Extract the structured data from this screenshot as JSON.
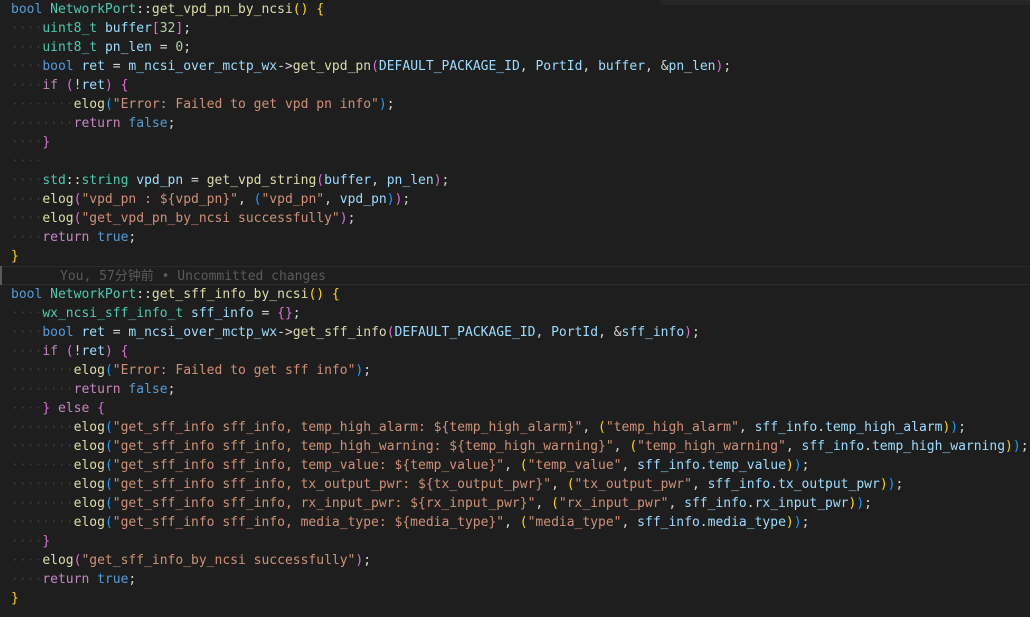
{
  "editor": {
    "blame_text": "You, 57分钟前 • Uncommitted changes",
    "lines": [
      [
        [
          "kw",
          "bool"
        ],
        [
          "op",
          " "
        ],
        [
          "type",
          "NetworkPort"
        ],
        [
          "op",
          "::"
        ],
        [
          "fn",
          "get_vpd_pn_by_ncsi"
        ],
        [
          "b1",
          "()"
        ],
        [
          "op",
          " "
        ],
        [
          "b1",
          "{"
        ]
      ],
      [
        [
          "ws",
          "····"
        ],
        [
          "type",
          "uint8_t"
        ],
        [
          "op",
          " "
        ],
        [
          "var",
          "buffer"
        ],
        [
          "b2",
          "["
        ],
        [
          "num",
          "32"
        ],
        [
          "b2",
          "]"
        ],
        [
          "op",
          ";"
        ]
      ],
      [
        [
          "ws",
          "····"
        ],
        [
          "type",
          "uint8_t"
        ],
        [
          "op",
          " "
        ],
        [
          "var",
          "pn_len"
        ],
        [
          "op",
          " = "
        ],
        [
          "num",
          "0"
        ],
        [
          "op",
          ";"
        ]
      ],
      [
        [
          "ws",
          "····"
        ],
        [
          "kw",
          "bool"
        ],
        [
          "op",
          " "
        ],
        [
          "var",
          "ret"
        ],
        [
          "op",
          " = "
        ],
        [
          "var",
          "m_ncsi_over_mctp_wx"
        ],
        [
          "op",
          "->"
        ],
        [
          "fn",
          "get_vpd_pn"
        ],
        [
          "b2",
          "("
        ],
        [
          "mac",
          "DEFAULT_PACKAGE_ID"
        ],
        [
          "op",
          ", "
        ],
        [
          "var",
          "PortId"
        ],
        [
          "op",
          ", "
        ],
        [
          "var",
          "buffer"
        ],
        [
          "op",
          ", &"
        ],
        [
          "var",
          "pn_len"
        ],
        [
          "b2",
          ")"
        ],
        [
          "op",
          ";"
        ]
      ],
      [
        [
          "ws",
          "····"
        ],
        [
          "ctrl",
          "if"
        ],
        [
          "op",
          " "
        ],
        [
          "b2",
          "("
        ],
        [
          "op",
          "!"
        ],
        [
          "var",
          "ret"
        ],
        [
          "b2",
          ")"
        ],
        [
          "op",
          " "
        ],
        [
          "b2",
          "{"
        ]
      ],
      [
        [
          "ws",
          "········"
        ],
        [
          "fn",
          "elog"
        ],
        [
          "b3",
          "("
        ],
        [
          "str",
          "\"Error: Failed to get vpd pn info\""
        ],
        [
          "b3",
          ")"
        ],
        [
          "op",
          ";"
        ]
      ],
      [
        [
          "ws",
          "········"
        ],
        [
          "ctrl",
          "return"
        ],
        [
          "op",
          " "
        ],
        [
          "kw",
          "false"
        ],
        [
          "op",
          ";"
        ]
      ],
      [
        [
          "ws",
          "····"
        ],
        [
          "b2",
          "}"
        ]
      ],
      [
        [
          "ws",
          "····"
        ]
      ],
      [
        [
          "ws",
          "····"
        ],
        [
          "type",
          "std"
        ],
        [
          "op",
          "::"
        ],
        [
          "type",
          "string"
        ],
        [
          "op",
          " "
        ],
        [
          "var",
          "vpd_pn"
        ],
        [
          "op",
          " = "
        ],
        [
          "fn",
          "get_vpd_string"
        ],
        [
          "b2",
          "("
        ],
        [
          "var",
          "buffer"
        ],
        [
          "op",
          ", "
        ],
        [
          "var",
          "pn_len"
        ],
        [
          "b2",
          ")"
        ],
        [
          "op",
          ";"
        ]
      ],
      [
        [
          "ws",
          "····"
        ],
        [
          "fn",
          "elog"
        ],
        [
          "b2",
          "("
        ],
        [
          "str",
          "\"vpd_pn : ${vpd_pn}\""
        ],
        [
          "op",
          ", "
        ],
        [
          "b3",
          "("
        ],
        [
          "str",
          "\"vpd_pn\""
        ],
        [
          "op",
          ", "
        ],
        [
          "var",
          "vpd_pn"
        ],
        [
          "b3",
          ")"
        ],
        [
          "b2",
          ")"
        ],
        [
          "op",
          ";"
        ]
      ],
      [
        [
          "ws",
          "····"
        ],
        [
          "fn",
          "elog"
        ],
        [
          "b2",
          "("
        ],
        [
          "str",
          "\"get_vpd_pn_by_ncsi successfully\""
        ],
        [
          "b2",
          ")"
        ],
        [
          "op",
          ";"
        ]
      ],
      [
        [
          "ws",
          "····"
        ],
        [
          "ctrl",
          "return"
        ],
        [
          "op",
          " "
        ],
        [
          "kw",
          "true"
        ],
        [
          "op",
          ";"
        ]
      ],
      [
        [
          "b1",
          "}"
        ]
      ],
      "BLAME",
      [
        [
          "kw",
          "bool"
        ],
        [
          "op",
          " "
        ],
        [
          "type",
          "NetworkPort"
        ],
        [
          "op",
          "::"
        ],
        [
          "fn",
          "get_sff_info_by_ncsi"
        ],
        [
          "b1",
          "()"
        ],
        [
          "op",
          " "
        ],
        [
          "b1",
          "{"
        ]
      ],
      [
        [
          "ws",
          "····"
        ],
        [
          "type",
          "wx_ncsi_sff_info_t"
        ],
        [
          "op",
          " "
        ],
        [
          "var",
          "sff_info"
        ],
        [
          "op",
          " = "
        ],
        [
          "b2",
          "{}"
        ],
        [
          "op",
          ";"
        ]
      ],
      [
        [
          "ws",
          "····"
        ],
        [
          "kw",
          "bool"
        ],
        [
          "op",
          " "
        ],
        [
          "var",
          "ret"
        ],
        [
          "op",
          " = "
        ],
        [
          "var",
          "m_ncsi_over_mctp_wx"
        ],
        [
          "op",
          "->"
        ],
        [
          "fn",
          "get_sff_info"
        ],
        [
          "b2",
          "("
        ],
        [
          "mac",
          "DEFAULT_PACKAGE_ID"
        ],
        [
          "op",
          ", "
        ],
        [
          "var",
          "PortId"
        ],
        [
          "op",
          ", &"
        ],
        [
          "var",
          "sff_info"
        ],
        [
          "b2",
          ")"
        ],
        [
          "op",
          ";"
        ]
      ],
      [
        [
          "ws",
          "····"
        ],
        [
          "ctrl",
          "if"
        ],
        [
          "op",
          " "
        ],
        [
          "b2",
          "("
        ],
        [
          "op",
          "!"
        ],
        [
          "var",
          "ret"
        ],
        [
          "b2",
          ")"
        ],
        [
          "op",
          " "
        ],
        [
          "b2",
          "{"
        ]
      ],
      [
        [
          "ws",
          "········"
        ],
        [
          "fn",
          "elog"
        ],
        [
          "b3",
          "("
        ],
        [
          "str",
          "\"Error: Failed to get sff info\""
        ],
        [
          "b3",
          ")"
        ],
        [
          "op",
          ";"
        ]
      ],
      [
        [
          "ws",
          "········"
        ],
        [
          "ctrl",
          "return"
        ],
        [
          "op",
          " "
        ],
        [
          "kw",
          "false"
        ],
        [
          "op",
          ";"
        ]
      ],
      [
        [
          "ws",
          "····"
        ],
        [
          "b2",
          "}"
        ],
        [
          "op",
          " "
        ],
        [
          "ctrl",
          "else"
        ],
        [
          "op",
          " "
        ],
        [
          "b2",
          "{"
        ]
      ],
      [
        [
          "ws",
          "········"
        ],
        [
          "fn",
          "elog"
        ],
        [
          "b3",
          "("
        ],
        [
          "str",
          "\"get_sff_info sff_info, temp_high_alarm: ${temp_high_alarm}\""
        ],
        [
          "op",
          ", "
        ],
        [
          "b1",
          "("
        ],
        [
          "str",
          "\"temp_high_alarm\""
        ],
        [
          "op",
          ", "
        ],
        [
          "var",
          "sff_info"
        ],
        [
          "op",
          "."
        ],
        [
          "var",
          "temp_high_alarm"
        ],
        [
          "b1",
          ")"
        ],
        [
          "b3",
          ")"
        ],
        [
          "op",
          ";"
        ]
      ],
      [
        [
          "ws",
          "········"
        ],
        [
          "fn",
          "elog"
        ],
        [
          "b3",
          "("
        ],
        [
          "str",
          "\"get_sff_info sff_info, temp_high_warning: ${temp_high_warning}\""
        ],
        [
          "op",
          ", "
        ],
        [
          "b1",
          "("
        ],
        [
          "str",
          "\"temp_high_warning\""
        ],
        [
          "op",
          ", "
        ],
        [
          "var",
          "sff_info"
        ],
        [
          "op",
          "."
        ],
        [
          "var",
          "temp_high_warning"
        ],
        [
          "b1",
          ")"
        ],
        [
          "b3",
          ")"
        ],
        [
          "op",
          ";"
        ]
      ],
      [
        [
          "ws",
          "········"
        ],
        [
          "fn",
          "elog"
        ],
        [
          "b3",
          "("
        ],
        [
          "str",
          "\"get_sff_info sff_info, temp_value: ${temp_value}\""
        ],
        [
          "op",
          ", "
        ],
        [
          "b1",
          "("
        ],
        [
          "str",
          "\"temp_value\""
        ],
        [
          "op",
          ", "
        ],
        [
          "var",
          "sff_info"
        ],
        [
          "op",
          "."
        ],
        [
          "var",
          "temp_value"
        ],
        [
          "b1",
          ")"
        ],
        [
          "b3",
          ")"
        ],
        [
          "op",
          ";"
        ]
      ],
      [
        [
          "ws",
          "········"
        ],
        [
          "fn",
          "elog"
        ],
        [
          "b3",
          "("
        ],
        [
          "str",
          "\"get_sff_info sff_info, tx_output_pwr: ${tx_output_pwr}\""
        ],
        [
          "op",
          ", "
        ],
        [
          "b1",
          "("
        ],
        [
          "str",
          "\"tx_output_pwr\""
        ],
        [
          "op",
          ", "
        ],
        [
          "var",
          "sff_info"
        ],
        [
          "op",
          "."
        ],
        [
          "var",
          "tx_output_pwr"
        ],
        [
          "b1",
          ")"
        ],
        [
          "b3",
          ")"
        ],
        [
          "op",
          ";"
        ]
      ],
      [
        [
          "ws",
          "········"
        ],
        [
          "fn",
          "elog"
        ],
        [
          "b3",
          "("
        ],
        [
          "str",
          "\"get_sff_info sff_info, rx_input_pwr: ${rx_input_pwr}\""
        ],
        [
          "op",
          ", "
        ],
        [
          "b1",
          "("
        ],
        [
          "str",
          "\"rx_input_pwr\""
        ],
        [
          "op",
          ", "
        ],
        [
          "var",
          "sff_info"
        ],
        [
          "op",
          "."
        ],
        [
          "var",
          "rx_input_pwr"
        ],
        [
          "b1",
          ")"
        ],
        [
          "b3",
          ")"
        ],
        [
          "op",
          ";"
        ]
      ],
      [
        [
          "ws",
          "········"
        ],
        [
          "fn",
          "elog"
        ],
        [
          "b3",
          "("
        ],
        [
          "str",
          "\"get_sff_info sff_info, media_type: ${media_type}\""
        ],
        [
          "op",
          ", "
        ],
        [
          "b1",
          "("
        ],
        [
          "str",
          "\"media_type\""
        ],
        [
          "op",
          ", "
        ],
        [
          "var",
          "sff_info"
        ],
        [
          "op",
          "."
        ],
        [
          "var",
          "media_type"
        ],
        [
          "b1",
          ")"
        ],
        [
          "b3",
          ")"
        ],
        [
          "op",
          ";"
        ]
      ],
      [
        [
          "ws",
          "····"
        ],
        [
          "b2",
          "}"
        ]
      ],
      [
        [
          "ws",
          "····"
        ],
        [
          "fn",
          "elog"
        ],
        [
          "b2",
          "("
        ],
        [
          "str",
          "\"get_sff_info_by_ncsi successfully\""
        ],
        [
          "b2",
          ")"
        ],
        [
          "op",
          ";"
        ]
      ],
      [
        [
          "ws",
          "····"
        ],
        [
          "ctrl",
          "return"
        ],
        [
          "op",
          " "
        ],
        [
          "kw",
          "true"
        ],
        [
          "op",
          ";"
        ]
      ],
      [
        [
          "b1",
          "}"
        ]
      ]
    ]
  }
}
